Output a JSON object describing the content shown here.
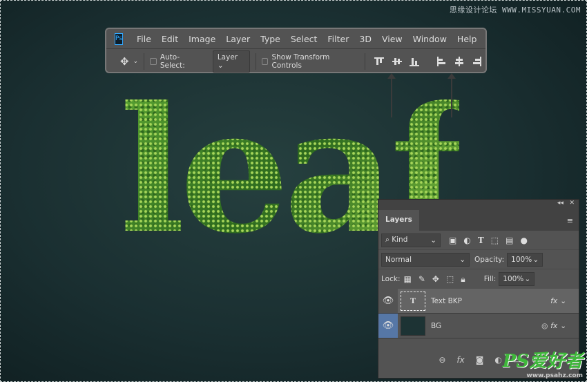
{
  "watermark_top": "思缘设计论坛 WWW.MISSYUAN.COM",
  "canvas_text": "leaf",
  "menu": {
    "logo": "Ps",
    "items": [
      "File",
      "Edit",
      "Image",
      "Layer",
      "Type",
      "Select",
      "Filter",
      "3D",
      "View",
      "Window",
      "Help"
    ]
  },
  "options": {
    "auto_select_label": "Auto-Select:",
    "auto_select_checked": false,
    "target_value": "Layer",
    "show_transform_label": "Show Transform Controls",
    "show_transform_checked": false
  },
  "layers_panel": {
    "tab": "Layers",
    "filter_value": "Kind",
    "blend_mode": "Normal",
    "opacity_label": "Opacity:",
    "opacity": "100%",
    "lock_label": "Lock:",
    "fill_label": "Fill:",
    "fill": "100%",
    "layers": [
      {
        "name": "Text BKP",
        "type": "text",
        "fx": "fx",
        "visible": true,
        "selected": false
      },
      {
        "name": "BG",
        "type": "smart-object",
        "fx": "fx",
        "visible": true,
        "selected": true
      }
    ]
  },
  "watermark_bottom": {
    "brand": "PS爱好者",
    "url": "www.psahz.com"
  },
  "colors": {
    "accent": "#31a8ff",
    "selected_eye": "#5677a6"
  }
}
